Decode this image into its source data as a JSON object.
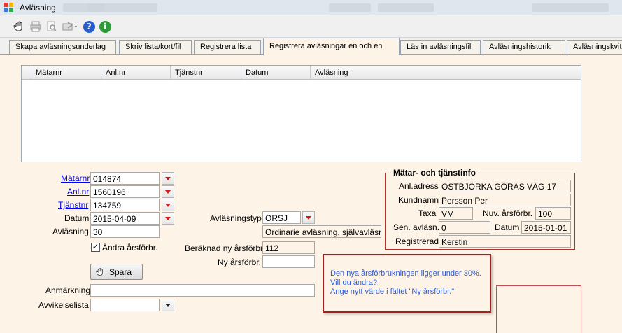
{
  "window": {
    "title": "Avläsning"
  },
  "toolbar": {
    "icons": [
      "hand-icon",
      "print-icon",
      "preview-icon",
      "export-icon",
      "help-icon",
      "info-icon"
    ],
    "help_glyph": "?",
    "info_glyph": "i"
  },
  "tabs": [
    {
      "label": "Skapa avläsningsunderlag",
      "active": false
    },
    {
      "label": "Skriv lista/kort/fil",
      "active": false
    },
    {
      "label": "Registrera lista",
      "active": false
    },
    {
      "label": "Registrera avläsningar en och en",
      "active": true
    },
    {
      "label": "Läs in avläsningsfil",
      "active": false
    },
    {
      "label": "Avläsningshistorik",
      "active": false
    },
    {
      "label": "Avläsningskvitt",
      "active": false
    }
  ],
  "grid": {
    "columns": [
      "Mätarnr",
      "Anl.nr",
      "Tjänstnr",
      "Datum",
      "Avläsning"
    ],
    "rows": []
  },
  "form": {
    "matarnr": {
      "label": "Mätarnr",
      "value": "014874"
    },
    "anlnr": {
      "label": "Anl.nr",
      "value": "1560196"
    },
    "tjanstnr": {
      "label": "Tjänstnr",
      "value": "134759"
    },
    "datum": {
      "label": "Datum",
      "value": "2015-04-09"
    },
    "avlasning": {
      "label": "Avläsning",
      "value": "30"
    },
    "andra_arsforbr": {
      "label": "Ändra årsförbr.",
      "checked": true,
      "mark": "✓"
    },
    "avlasningstyp": {
      "label": "Avläsningstyp",
      "value": "ORSJ",
      "description": "Ordinarie avläsning, självavläsning"
    },
    "beraknad_ny": {
      "label": "Beräknad ny årsförbr.",
      "value": "112"
    },
    "ny_arsforbr": {
      "label": "Ny årsförbr.",
      "value": ""
    },
    "spara_label": "Spara",
    "anmarkning": {
      "label": "Anmärkning",
      "value": ""
    },
    "avvikelselista": {
      "label": "Avvikelselista",
      "value": ""
    }
  },
  "info": {
    "legend": "Mätar- och tjänstinfo",
    "anladress": {
      "label": "Anl.adress",
      "value": "ÖSTBJÖRKA GÖRAS VÄG 17"
    },
    "kundnamn": {
      "label": "Kundnamn",
      "value": "Persson Per"
    },
    "taxa": {
      "label": "Taxa",
      "value": "VM"
    },
    "nuv_arsforbr": {
      "label": "Nuv. årsförbr.",
      "value": "100"
    },
    "sen_avlasn": {
      "label": "Sen. avläsn.",
      "value": "0"
    },
    "datum": {
      "label": "Datum",
      "value": "2015-01-01"
    },
    "registrerad": {
      "label": "Registrerad",
      "value": "Kerstin"
    }
  },
  "warning": {
    "lines": [
      "Den nya årsförbrukningen ligger under 30%.",
      "Vill du ändra?",
      "Ange nytt värde i fältet \"Ny årsförbr.\""
    ]
  },
  "colors": {
    "accent_red": "#d11111",
    "link": "#0000ee",
    "warning_text": "#2b5bd6",
    "form_bg": "#fdf3e7"
  }
}
